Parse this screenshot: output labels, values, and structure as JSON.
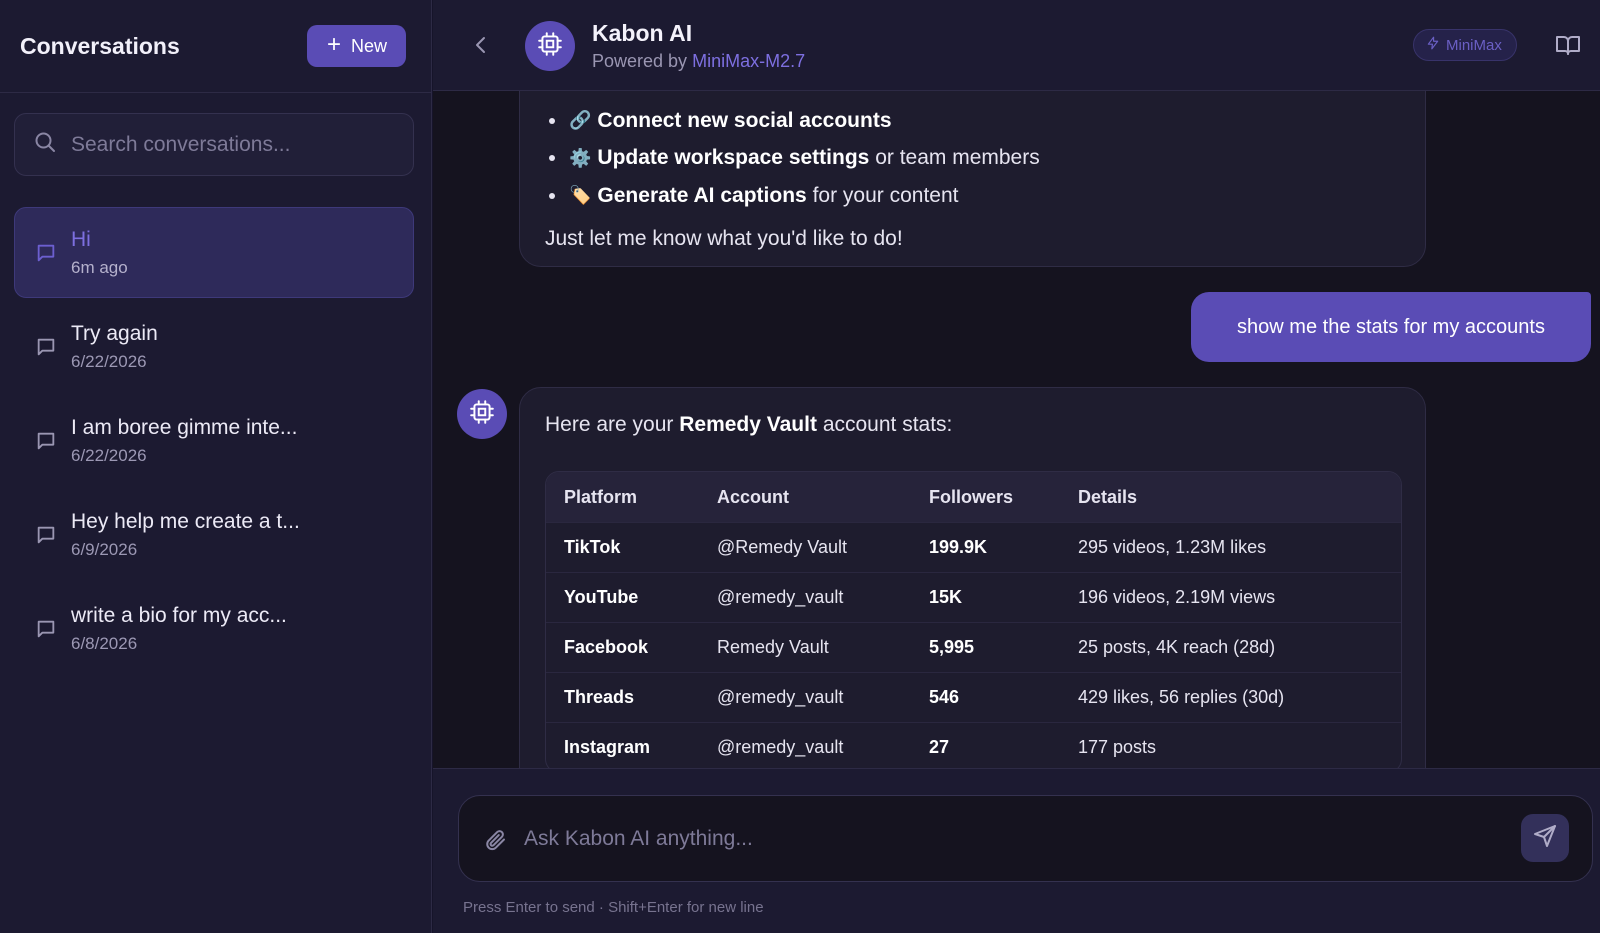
{
  "sidebar": {
    "title": "Conversations",
    "new_label": "New",
    "search_placeholder": "Search conversations...",
    "conversations": [
      {
        "title": "Hi",
        "date": "6m ago",
        "active": true
      },
      {
        "title": "Try again",
        "date": "6/22/2026"
      },
      {
        "title": "I am boree gimme inte...",
        "date": "6/22/2026"
      },
      {
        "title": "Hey help me create a t...",
        "date": "6/9/2026"
      },
      {
        "title": "write a bio for my acc...",
        "date": "6/8/2026"
      }
    ]
  },
  "header": {
    "title": "Kabon AI",
    "powered_prefix": "Powered by",
    "model": "MiniMax-M2.7",
    "badge": "MiniMax"
  },
  "messages": {
    "ai1": {
      "bullets": [
        {
          "emoji": "🔗",
          "bold": "Connect new social accounts",
          "rest": ""
        },
        {
          "emoji": "⚙️",
          "bold": "Update workspace settings",
          "rest": "or team members"
        },
        {
          "emoji": "🏷️",
          "bold": "Generate AI captions",
          "rest": "for your content"
        }
      ],
      "closing": "Just let me know what you'd like to do!"
    },
    "user1": "show me the stats for my accounts",
    "ai2": {
      "intro_pre": "Here are your",
      "intro_bold": "Remedy Vault",
      "intro_post": "account stats:",
      "table": {
        "headers": [
          "Platform",
          "Account",
          "Followers",
          "Details"
        ],
        "rows": [
          [
            "TikTok",
            "@Remedy Vault",
            "199.9K",
            "295 videos, 1.23M likes"
          ],
          [
            "YouTube",
            "@remedy_vault",
            "15K",
            "196 videos, 2.19M views"
          ],
          [
            "Facebook",
            "Remedy Vault",
            "5,995",
            "25 posts, 4K reach (28d)"
          ],
          [
            "Threads",
            "@remedy_vault",
            "546",
            "429 likes, 56 replies (30d)"
          ],
          [
            "Instagram",
            "@remedy_vault",
            "27",
            "177 posts"
          ]
        ]
      }
    }
  },
  "composer": {
    "placeholder": "Ask Kabon AI anything...",
    "hint": "Press Enter to send · Shift+Enter for new line"
  },
  "colors": {
    "accent": "#5a4cb5",
    "accent_text": "#7d6fe0",
    "sidebar_bg": "#1c1a31",
    "chat_bg": "#15131f"
  }
}
